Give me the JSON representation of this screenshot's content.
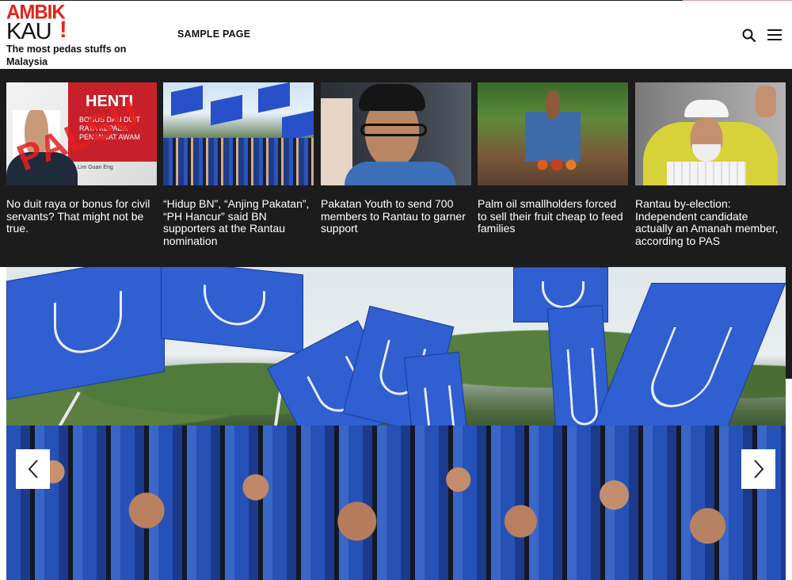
{
  "site": {
    "logo_line1": "AMBIK",
    "logo_line2": "KAU",
    "logo_bang": "!",
    "tagline": "The most pedas stuffs on Malaysia",
    "brand_red": "#e2231a"
  },
  "nav": {
    "links": [
      {
        "label": "SAMPLE PAGE"
      }
    ],
    "search_icon": "search-icon",
    "menu_icon": "hamburger-menu-icon"
  },
  "news": {
    "background": "#1c1c1c",
    "items": [
      {
        "title": "No duit raya or bonus for civil servants? That might not be true.",
        "thumb_text": "HENTI",
        "thumb_sub": "BONUS DAN DUIT RAYA KEPADA PENJAWAT AWAM",
        "stamp": "PALSU",
        "caption": "Lim Guan Eng"
      },
      {
        "title": "“Hidup BN”, “Anjing Pakatan”, “PH Hancur” said BN supporters at the Rantau nomination"
      },
      {
        "title": "Pakatan Youth to send 700 members to Rantau to garner support"
      },
      {
        "title": "Palm oil smallholders forced to sell their fruit cheap to feed families"
      },
      {
        "title": "Rantau by-election: Independent candidate actually an Amanah member, according to PAS"
      }
    ]
  },
  "slider": {
    "prev_icon": "chevron-left-icon",
    "next_icon": "chevron-right-icon"
  }
}
